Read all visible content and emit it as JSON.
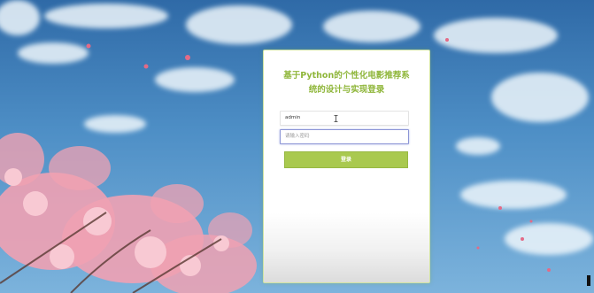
{
  "login": {
    "title_line1": "基于Python的个性化电影推荐系",
    "title_line2": "统的设计与实现登录",
    "username_value": "admin",
    "password_placeholder": "请输入密码",
    "submit_label": "登录"
  },
  "colors": {
    "accent": "#a9c94f",
    "title": "#8fb63a",
    "focus_border": "#8c95d6"
  },
  "icons": {
    "cursor": "text-cursor-icon"
  }
}
